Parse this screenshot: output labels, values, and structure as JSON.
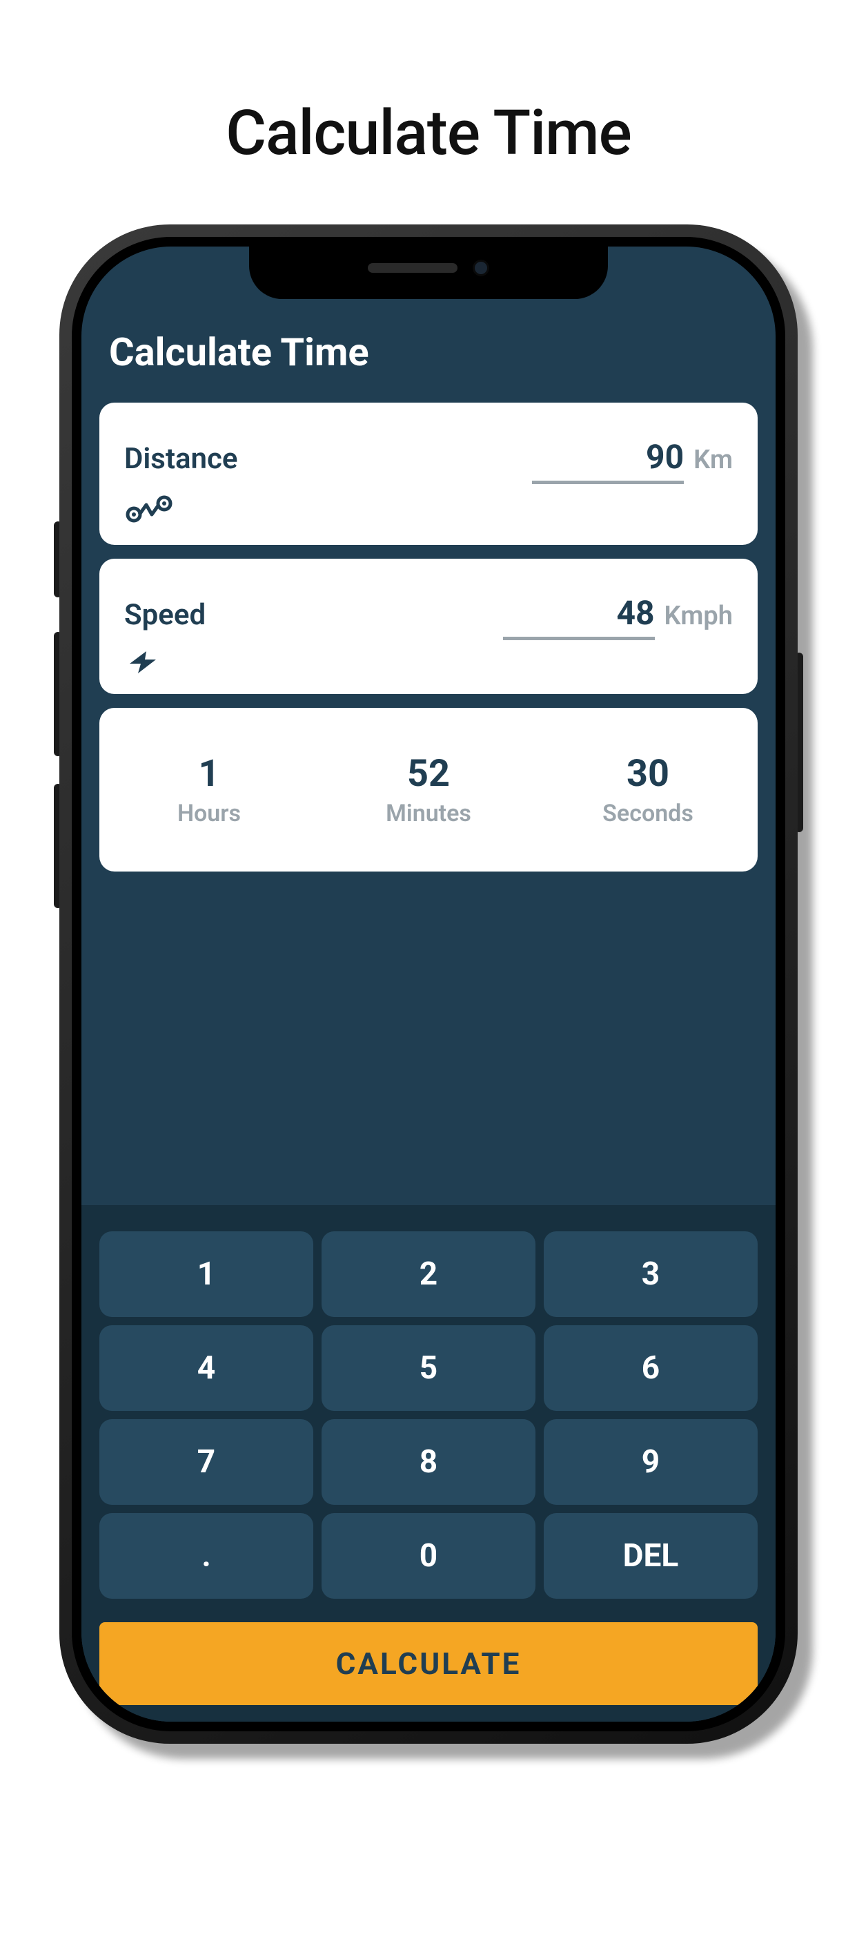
{
  "page": {
    "title": "Calculate Time"
  },
  "app": {
    "title": "Calculate Time"
  },
  "inputs": {
    "distance": {
      "label": "Distance",
      "value": "90",
      "unit": "Km"
    },
    "speed": {
      "label": "Speed",
      "value": "48",
      "unit": "Kmph"
    }
  },
  "result": {
    "hours": {
      "value": "1",
      "label": "Hours"
    },
    "minutes": {
      "value": "52",
      "label": "Minutes"
    },
    "seconds": {
      "value": "30",
      "label": "Seconds"
    }
  },
  "keypad": {
    "k1": "1",
    "k2": "2",
    "k3": "3",
    "k4": "4",
    "k5": "5",
    "k6": "6",
    "k7": "7",
    "k8": "8",
    "k9": "9",
    "kdot": ".",
    "k0": "0",
    "kdel": "DEL"
  },
  "actions": {
    "calculate": "CALCULATE"
  }
}
